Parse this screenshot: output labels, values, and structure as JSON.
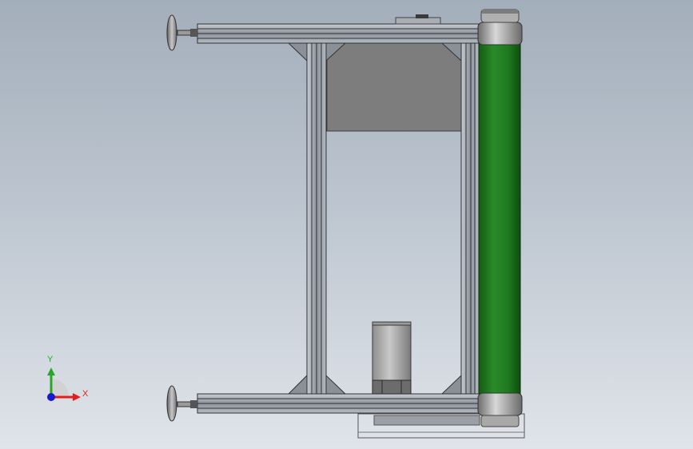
{
  "viewport": {
    "background_top": "#a3aebb",
    "background_bottom": "#e0e4ea"
  },
  "model": {
    "frame_color": "#9aa0a8",
    "panel_color": "#7a7a7a",
    "belt_color": "#1f7a1f",
    "roller_color": "#9a9a9a"
  },
  "triad": {
    "x_label": "X",
    "y_label": "Y",
    "x_color": "#e02020",
    "y_color": "#2aa52a",
    "z_color": "#1a1acc"
  }
}
